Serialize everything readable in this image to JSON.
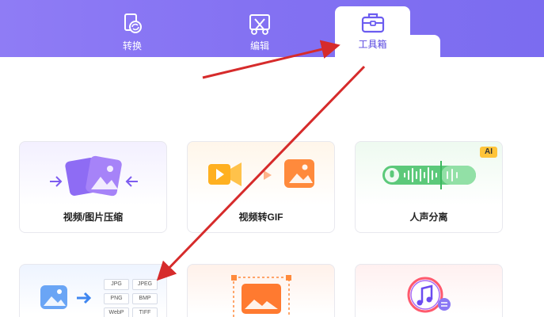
{
  "header": {
    "tabs": [
      {
        "label": "转换",
        "icon": "convert-icon"
      },
      {
        "label": "编辑",
        "icon": "edit-scissors-icon"
      },
      {
        "label": "工具箱",
        "icon": "toolbox-icon",
        "active": true
      }
    ]
  },
  "tools": [
    {
      "title": "视频/图片压缩",
      "icon": "compress-icon"
    },
    {
      "title": "视频转GIF",
      "icon": "video-to-gif-icon"
    },
    {
      "title": "人声分离",
      "icon": "voice-separation-icon",
      "badge": "AI"
    },
    {
      "title": "",
      "icon": "image-format-convert-icon",
      "formats": [
        "JPG",
        "JPEG",
        "PNG",
        "BMP",
        "WebP",
        "TIFF"
      ]
    },
    {
      "title": "",
      "icon": "image-crop-icon"
    },
    {
      "title": "",
      "icon": "music-convert-icon"
    }
  ],
  "colors": {
    "header": "#8371f2",
    "accent": "#6b5cf0",
    "annotation_arrow": "#d62b2b",
    "ai_badge": "#ffc43a"
  }
}
